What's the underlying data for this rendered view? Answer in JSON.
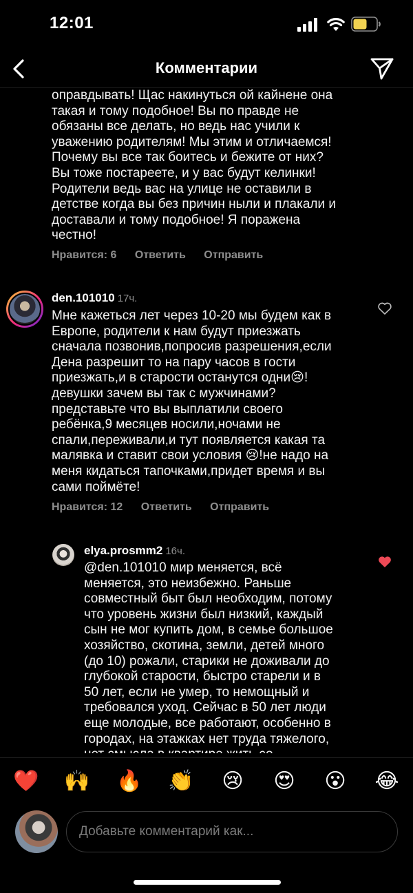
{
  "status_bar": {
    "time": "12:01",
    "battery_color": "#f2d351"
  },
  "header": {
    "title": "Комментарии",
    "back_icon": "chevron-left-icon",
    "send_icon": "paper-plane-icon"
  },
  "comments": [
    {
      "text": "оправдывать! Щас накинуться ой кайнене она\nтакая и тому подобное! Вы по правде не\nобязаны все делать, но ведь нас учили к\nуважению родителям! Мы этим и отличаемся!\nПочему вы все так боитесь и бежите от них?\nВы тоже постареете, и у вас будут келинки!\nРодители ведь вас на улице не оставили в\nдетстве когда вы без причин ныли и плакали и\nдоставали и тому подобное! Я поражена\nчестно!",
      "likes_label": "Нравится: 6",
      "reply_label": "Ответить",
      "send_label": "Отправить"
    },
    {
      "username": "den.101010",
      "time": "17ч.",
      "text": "Мне кажеться лет через 10-20 мы будем как в\nЕвропе, родители к нам будут приезжать\nсначала позвонив,попросив разрешения,если\nДена разрешит то на пару часов в гости\nприезжать,и в старости останутся одни😢!\nдевушки зачем вы так с мужчинами?\nпредставьте что вы выплатили своего\nребёнка,9 месяцев носили,ночами не\nспали,переживали,и тут появляется какая та\nмалявка и ставит свои условия 😢!не надо на\nменя кидаться тапочками,придет время и вы\nсами поймёте!",
      "likes_label": "Нравится: 12",
      "reply_label": "Ответить",
      "send_label": "Отправить",
      "liked": false
    },
    {
      "username": "elya.prosmm2",
      "time": "16ч.",
      "text": "@den.101010 мир меняется, всё\nменяется, это неизбежно. Раньше\nсовместный быт был необходим, потому\nчто уровень жизни был низкий, каждый\nсын не мог купить дом, в семье большое\nхозяйство, скотина, земли, детей много\n(до 10) рожали, старики не доживали до\nглубокой старости, быстро старели и в\n50 лет, если не умер, то немощный и\nтребовался уход. Сейчас в 50 лет люди\nеще молодые, все работают, особенно в\nгородах, на этажках нет труда тяжелого,\nнет смысла в квартире жить со",
      "liked": true,
      "like_color": "#ed4956"
    }
  ],
  "emoji_bar": [
    "❤️",
    "🙌",
    "🔥",
    "👏",
    "😢",
    "😍",
    "😮",
    "😂"
  ],
  "composer": {
    "placeholder": "Добавьте комментарий как..."
  }
}
